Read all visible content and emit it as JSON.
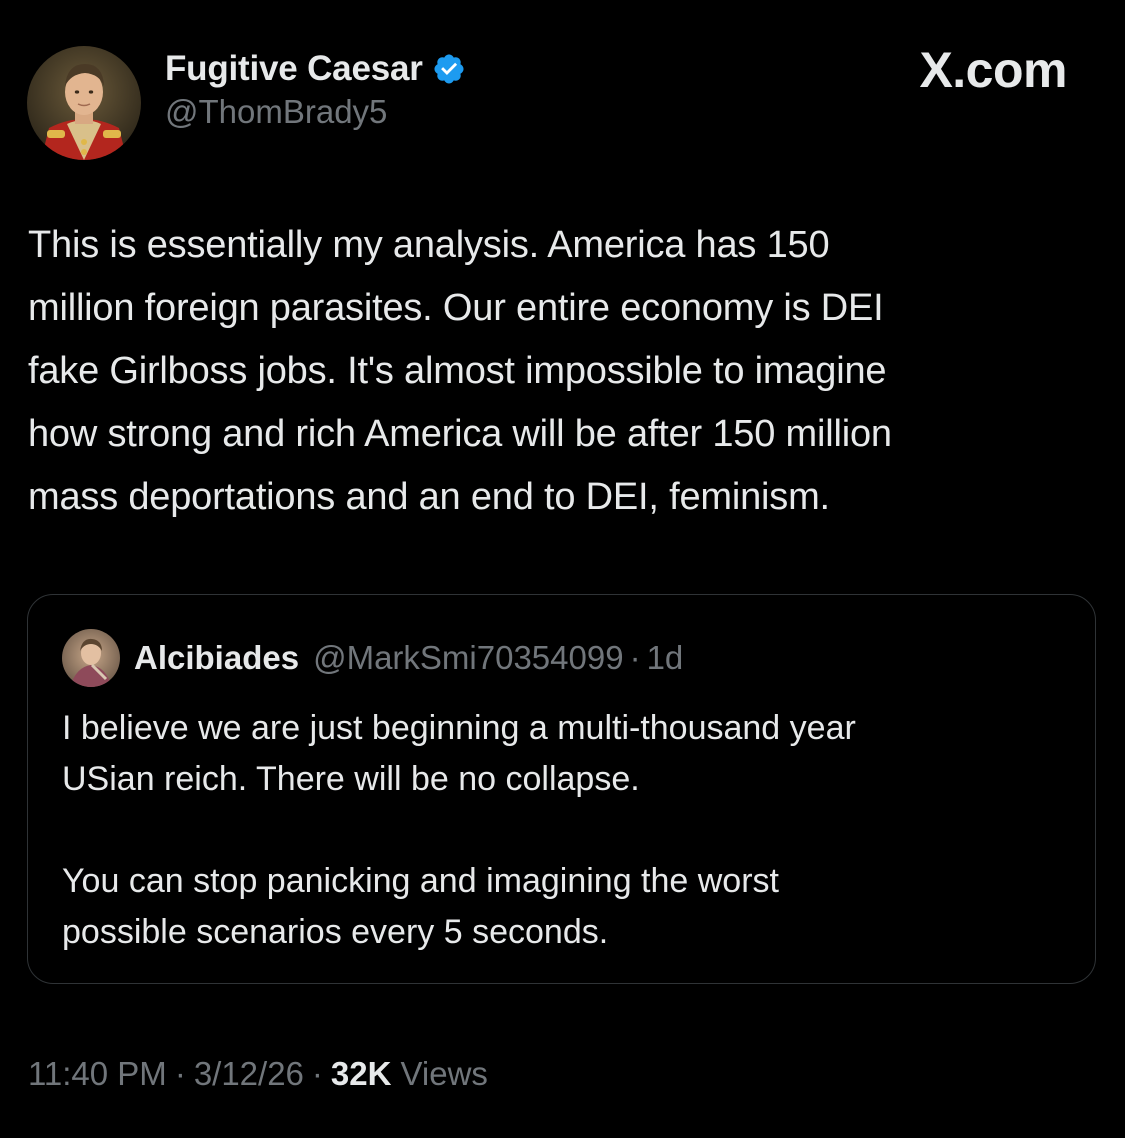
{
  "tweet": {
    "author": {
      "display_name": "Fugitive Caesar",
      "handle": "@ThomBrady5",
      "verified": true,
      "avatar_icon": "avatar-portrait-red-uniform"
    },
    "brand": "X.com",
    "text_lines": [
      "This is essentially my analysis. America has 150",
      "million foreign parasites. Our entire economy is DEI",
      "fake Girlboss jobs. It's almost impossible to imagine",
      "how strong and rich America will be after 150 million",
      "mass deportations and an end to DEI, feminism."
    ],
    "quote": {
      "display_name": "Alcibiades",
      "handle": "@MarkSmi70354099",
      "separator": "·",
      "time": "1d",
      "avatar_icon": "avatar-classical-painting",
      "paragraph1_lines": [
        "I believe we are just beginning a multi-thousand year",
        "USian reich. There will be no collapse."
      ],
      "paragraph2_lines": [
        "You can stop panicking and imagining the worst",
        "possible scenarios every 5 seconds."
      ]
    },
    "meta": {
      "time": "11:40 PM",
      "separator": "·",
      "date": "3/12/26",
      "views_count": "32K",
      "views_label": "Views"
    }
  },
  "colors": {
    "background": "#000000",
    "text_primary": "#e7e9ea",
    "text_secondary": "#71767b",
    "border": "#2f3336",
    "verified_blue": "#1d9bf0"
  }
}
